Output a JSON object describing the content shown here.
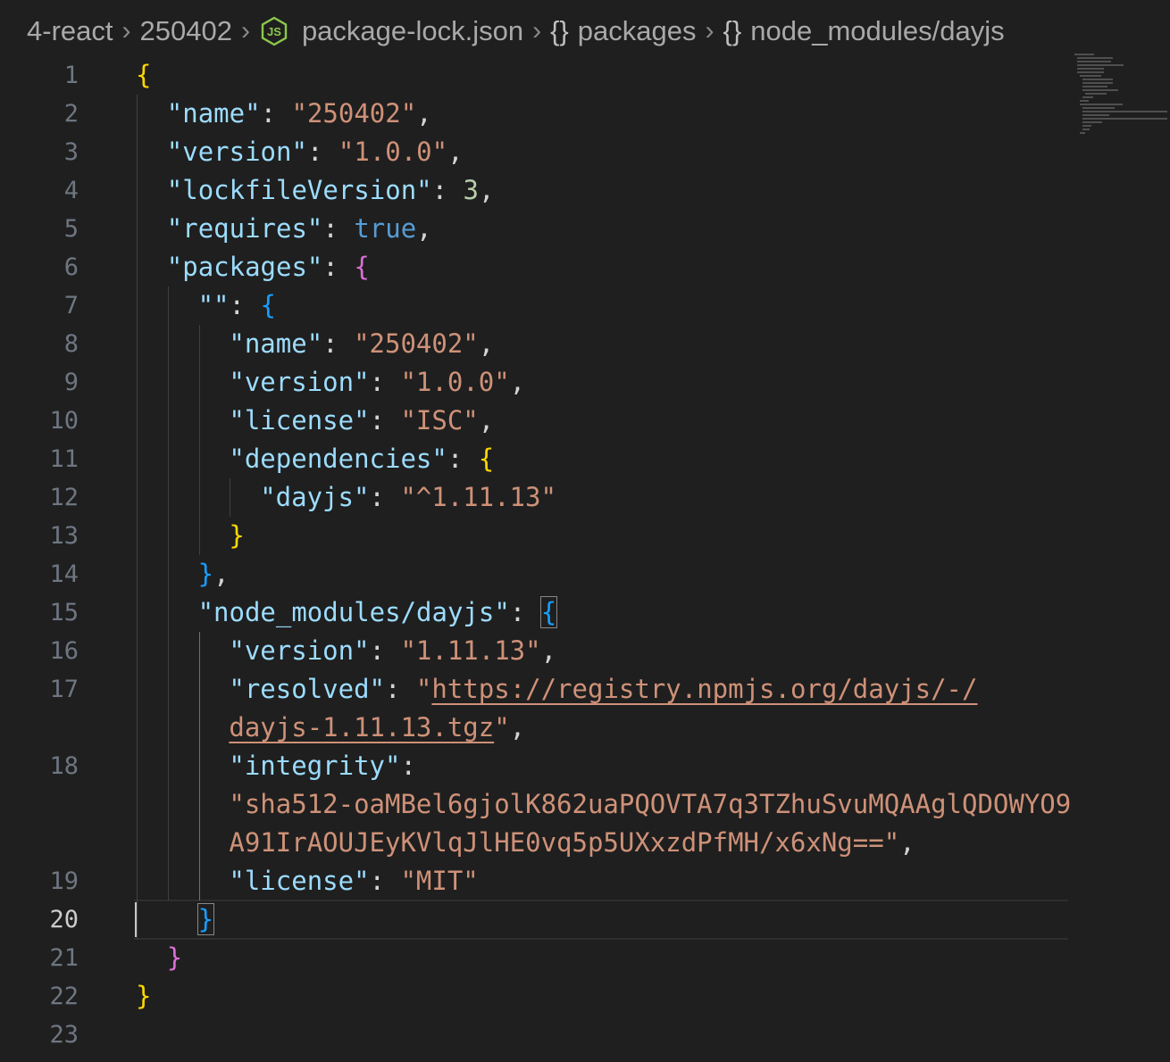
{
  "breadcrumb": {
    "items": [
      "4-react",
      "250402",
      "package-lock.json",
      "packages",
      "node_modules/dayjs"
    ],
    "file_icon_label": "JS",
    "object_icon": "{}"
  },
  "editor": {
    "active_line": "20",
    "line_numbers": [
      "1",
      "2",
      "3",
      "4",
      "5",
      "6",
      "7",
      "8",
      "9",
      "10",
      "11",
      "12",
      "13",
      "14",
      "15",
      "16",
      "17",
      "18",
      "19",
      "20",
      "21",
      "22",
      "23"
    ],
    "lines": [
      {
        "ln": "1",
        "tokens": [
          {
            "t": "b1",
            "v": "{"
          }
        ]
      },
      {
        "ln": "2",
        "tokens": [
          {
            "t": "key",
            "v": "\"name\""
          },
          {
            "t": "punc",
            "v": ": "
          },
          {
            "t": "str",
            "v": "\"250402\""
          },
          {
            "t": "punc",
            "v": ","
          }
        ]
      },
      {
        "ln": "3",
        "tokens": [
          {
            "t": "key",
            "v": "\"version\""
          },
          {
            "t": "punc",
            "v": ": "
          },
          {
            "t": "str",
            "v": "\"1.0.0\""
          },
          {
            "t": "punc",
            "v": ","
          }
        ]
      },
      {
        "ln": "4",
        "tokens": [
          {
            "t": "key",
            "v": "\"lockfileVersion\""
          },
          {
            "t": "punc",
            "v": ": "
          },
          {
            "t": "num",
            "v": "3"
          },
          {
            "t": "punc",
            "v": ","
          }
        ]
      },
      {
        "ln": "5",
        "tokens": [
          {
            "t": "key",
            "v": "\"requires\""
          },
          {
            "t": "punc",
            "v": ": "
          },
          {
            "t": "bool",
            "v": "true"
          },
          {
            "t": "punc",
            "v": ","
          }
        ]
      },
      {
        "ln": "6",
        "tokens": [
          {
            "t": "key",
            "v": "\"packages\""
          },
          {
            "t": "punc",
            "v": ": "
          },
          {
            "t": "b2",
            "v": "{"
          }
        ]
      },
      {
        "ln": "7",
        "tokens": [
          {
            "t": "key",
            "v": "\"\""
          },
          {
            "t": "punc",
            "v": ": "
          },
          {
            "t": "b3",
            "v": "{"
          }
        ]
      },
      {
        "ln": "8",
        "tokens": [
          {
            "t": "key",
            "v": "\"name\""
          },
          {
            "t": "punc",
            "v": ": "
          },
          {
            "t": "str",
            "v": "\"250402\""
          },
          {
            "t": "punc",
            "v": ","
          }
        ]
      },
      {
        "ln": "9",
        "tokens": [
          {
            "t": "key",
            "v": "\"version\""
          },
          {
            "t": "punc",
            "v": ": "
          },
          {
            "t": "str",
            "v": "\"1.0.0\""
          },
          {
            "t": "punc",
            "v": ","
          }
        ]
      },
      {
        "ln": "10",
        "tokens": [
          {
            "t": "key",
            "v": "\"license\""
          },
          {
            "t": "punc",
            "v": ": "
          },
          {
            "t": "str",
            "v": "\"ISC\""
          },
          {
            "t": "punc",
            "v": ","
          }
        ]
      },
      {
        "ln": "11",
        "tokens": [
          {
            "t": "key",
            "v": "\"dependencies\""
          },
          {
            "t": "punc",
            "v": ": "
          },
          {
            "t": "b1",
            "v": "{"
          }
        ]
      },
      {
        "ln": "12",
        "tokens": [
          {
            "t": "key",
            "v": "\"dayjs\""
          },
          {
            "t": "punc",
            "v": ": "
          },
          {
            "t": "str",
            "v": "\"^1.11.13\""
          }
        ]
      },
      {
        "ln": "13",
        "tokens": [
          {
            "t": "b1",
            "v": "}"
          }
        ]
      },
      {
        "ln": "14",
        "tokens": [
          {
            "t": "b3",
            "v": "}"
          },
          {
            "t": "punc",
            "v": ","
          }
        ]
      },
      {
        "ln": "15",
        "tokens": [
          {
            "t": "key",
            "v": "\"node_modules/dayjs\""
          },
          {
            "t": "punc",
            "v": ": "
          },
          {
            "t": "b3m",
            "v": "{"
          }
        ]
      },
      {
        "ln": "16",
        "tokens": [
          {
            "t": "key",
            "v": "\"version\""
          },
          {
            "t": "punc",
            "v": ": "
          },
          {
            "t": "str",
            "v": "\"1.11.13\""
          },
          {
            "t": "punc",
            "v": ","
          }
        ]
      },
      {
        "ln": "17",
        "tokens": [
          {
            "t": "key",
            "v": "\"resolved\""
          },
          {
            "t": "punc",
            "v": ": "
          },
          {
            "t": "str",
            "v": "\""
          },
          {
            "t": "link",
            "v": "https://registry.npmjs.org/dayjs/-/"
          }
        ]
      },
      {
        "ln": "",
        "tokens": [
          {
            "t": "link",
            "v": "dayjs-1.11.13.tgz"
          },
          {
            "t": "str",
            "v": "\""
          },
          {
            "t": "punc",
            "v": ","
          }
        ]
      },
      {
        "ln": "18",
        "tokens": [
          {
            "t": "key",
            "v": "\"integrity\""
          },
          {
            "t": "punc",
            "v": ":"
          }
        ]
      },
      {
        "ln": "",
        "tokens": [
          {
            "t": "str",
            "v": "\"sha512-oaMBel6gjolK862uaPQOVTA7q3TZhuSvuMQAAglQDOWYO9"
          }
        ]
      },
      {
        "ln": "",
        "tokens": [
          {
            "t": "str",
            "v": "A91IrAOUJEyKVlqJlHE0vq5p5UXxzdPfMH/x6xNg==\""
          },
          {
            "t": "punc",
            "v": ","
          }
        ]
      },
      {
        "ln": "19",
        "tokens": [
          {
            "t": "key",
            "v": "\"license\""
          },
          {
            "t": "punc",
            "v": ": "
          },
          {
            "t": "str",
            "v": "\"MIT\""
          }
        ]
      },
      {
        "ln": "20",
        "tokens": [
          {
            "t": "b3m",
            "v": "}"
          }
        ]
      },
      {
        "ln": "21",
        "tokens": [
          {
            "t": "b2",
            "v": "}"
          }
        ]
      },
      {
        "ln": "22",
        "tokens": [
          {
            "t": "b1",
            "v": "}"
          }
        ]
      },
      {
        "ln": "23",
        "tokens": []
      }
    ]
  },
  "colors": {
    "background": "#1f1f1f",
    "key": "#9cdcfe",
    "string": "#ce9178",
    "number": "#b5cea8",
    "boolean": "#569cd6",
    "bracket_level1": "#ffd700",
    "bracket_level2": "#da70d6",
    "bracket_level3": "#179fff",
    "node_icon": "#8cc84b"
  }
}
